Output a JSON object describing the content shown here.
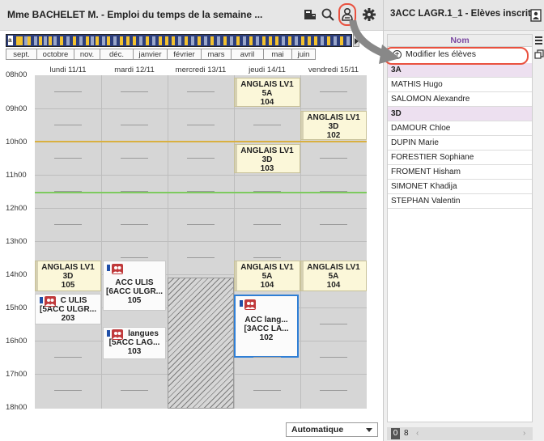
{
  "left": {
    "title": "Mme BACHELET M. - Emploi du temps de la semaine ...",
    "months": [
      "sept.",
      "octobre",
      "nov.",
      "déc.",
      "janvier",
      "février",
      "mars",
      "avril",
      "mai",
      "juin"
    ],
    "days": [
      "lundi 11/11",
      "mardi 12/11",
      "mercredi 13/11",
      "jeudi 14/11",
      "vendredi 15/11"
    ],
    "hours": [
      "08h00",
      "09h00",
      "10h00",
      "11h00",
      "12h00",
      "13h00",
      "14h00",
      "15h00",
      "16h00",
      "17h00",
      "18h00"
    ],
    "courses": {
      "c1": {
        "name": "ANGLAIS LV1",
        "group": "5A",
        "room": "104"
      },
      "c2": {
        "name": "ANGLAIS LV1",
        "group": "3D",
        "room": "102"
      },
      "c3": {
        "name": "ANGLAIS LV1",
        "group": "3D",
        "room": "103"
      },
      "c4": {
        "name": "ANGLAIS LV1",
        "group": "3D",
        "room": "105"
      },
      "c5": {
        "name": "ANGLAIS LV1",
        "group": "5A",
        "room": "104"
      },
      "c6": {
        "name": "ANGLAIS LV1",
        "group": "5A",
        "room": "104"
      },
      "c7": {
        "name": "C ULIS",
        "group": "[5ACC ULGR...",
        "room": "203"
      },
      "c8": {
        "name": "ACC ULIS",
        "group": "[6ACC ULGR...",
        "room": "105"
      },
      "c9": {
        "name": "langues",
        "group": "[5ACC LAG...",
        "room": "103"
      },
      "c10": {
        "name": "ACC lang...",
        "group": "[3ACC LA...",
        "room": "102"
      }
    },
    "selector": "Automatique"
  },
  "right": {
    "title": "3ACC LAGR.1_1 - Elèves inscrits",
    "column": "Nom",
    "modify_label": "Modifier les élèves",
    "rows": [
      {
        "text": "3A",
        "cls": true
      },
      {
        "text": "MATHIS Hugo",
        "cls": false
      },
      {
        "text": "SALOMON Alexandre",
        "cls": false
      },
      {
        "text": "3D",
        "cls": true
      },
      {
        "text": "DAMOUR Chloe",
        "cls": false
      },
      {
        "text": "DUPIN Marie",
        "cls": false
      },
      {
        "text": "FORESTIER Sophiane",
        "cls": false
      },
      {
        "text": "FROMENT Hisham",
        "cls": false
      },
      {
        "text": "SIMONET Khadija",
        "cls": false
      },
      {
        "text": "STEPHAN Valentin",
        "cls": false
      }
    ],
    "pager": {
      "first": "0",
      "second": "8"
    }
  },
  "icons": [
    "calendar-icon",
    "search-icon",
    "person-icon",
    "gear-icon",
    "export-icon",
    "menu-icon",
    "copy-icon",
    "plus-circle-icon"
  ],
  "colors": {
    "accent_red": "#e9513f",
    "course_yellow": "#fbf7d9",
    "selection_blue": "#2f7fd6",
    "class_row": "#ede0f0"
  }
}
